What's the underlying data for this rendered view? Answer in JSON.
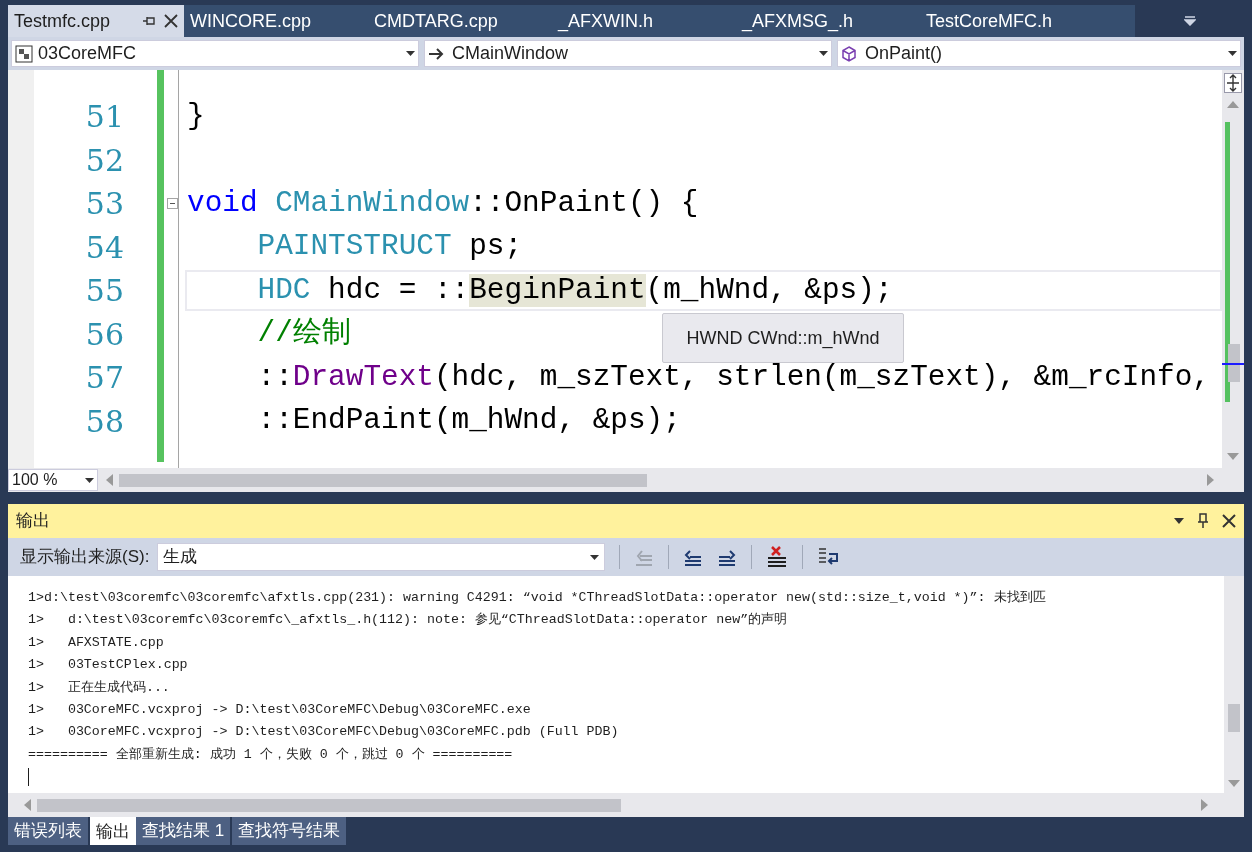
{
  "tabs": [
    {
      "label": "Testmfc.cpp",
      "selected": true
    },
    {
      "label": "WINCORE.cpp",
      "selected": false
    },
    {
      "label": "CMDTARG.cpp",
      "selected": false
    },
    {
      "label": "_AFXWIN.h",
      "selected": false
    },
    {
      "label": "_AFXMSG_.h",
      "selected": false
    },
    {
      "label": "TestCoreMFC.h",
      "selected": false
    }
  ],
  "nav": {
    "project": "03CoreMFC",
    "class": "CMainWindow",
    "member": "OnPaint()"
  },
  "editor": {
    "lines": [
      {
        "number": "51",
        "tokens": [
          {
            "text": "}",
            "kind": "plain"
          }
        ]
      },
      {
        "number": "52"
      },
      {
        "number": "53",
        "foldable": true,
        "tokens": [
          {
            "text": "void ",
            "kind": "keyword"
          },
          {
            "text": "CMainWindow",
            "kind": "type"
          },
          {
            "text": "::OnPaint() {",
            "kind": "plain"
          }
        ]
      },
      {
        "number": "54",
        "tokens": [
          {
            "text": "    PAINTSTRUCT",
            "kind": "type"
          },
          {
            "text": " ps;",
            "kind": "plain"
          }
        ]
      },
      {
        "number": "55",
        "current": true,
        "tokens": [
          {
            "text": "    HDC",
            "kind": "type"
          },
          {
            "text": " hdc = ::",
            "kind": "plain"
          },
          {
            "text": "BeginPaint",
            "kind": "highlight"
          },
          {
            "text": "(m_hWnd, &ps);",
            "kind": "plain"
          }
        ]
      },
      {
        "number": "56",
        "tokens": [
          {
            "text": "    //绘制",
            "kind": "comment"
          }
        ]
      },
      {
        "number": "57",
        "tokens": [
          {
            "text": "    ::",
            "kind": "plain"
          },
          {
            "text": "DrawText",
            "kind": "function"
          },
          {
            "text": "(hdc, m_szText, strlen(m_szText), &m_rcInfo,",
            "kind": "plain"
          }
        ]
      },
      {
        "number": "58",
        "tokens": [
          {
            "text": "    ::EndPaint(m_hWnd, &ps);",
            "kind": "plain"
          }
        ]
      }
    ],
    "tooltip": "HWND CWnd::m_hWnd",
    "zoom": "100 %"
  },
  "output": {
    "title": "输出",
    "source_label": "显示输出来源(S):",
    "source": "生成",
    "lines": [
      "1>d:\\test\\03coremfc\\03coremfc\\afxtls.cpp(231): warning C4291: “void *CThreadSlotData::operator new(std::size_t,void *)”: 未找到匹",
      "1>   d:\\test\\03coremfc\\03coremfc\\_afxtls_.h(112): note: 参见“CThreadSlotData::operator new”的声明",
      "1>   AFXSTATE.cpp",
      "1>   03TestCPlex.cpp",
      "1>   正在生成代码...",
      "1>   03CoreMFC.vcxproj -> D:\\test\\03CoreMFC\\Debug\\03CoreMFC.exe",
      "1>   03CoreMFC.vcxproj -> D:\\test\\03CoreMFC\\Debug\\03CoreMFC.pdb (Full PDB)",
      "========== 全部重新生成: 成功 1 个，失败 0 个，跳过 0 个 =========="
    ]
  },
  "bottom_tabs": [
    {
      "label": "错误列表",
      "selected": false
    },
    {
      "label": "输出",
      "selected": true
    },
    {
      "label": "查找结果 1",
      "selected": false
    },
    {
      "label": "查找符号结果",
      "selected": false
    }
  ]
}
